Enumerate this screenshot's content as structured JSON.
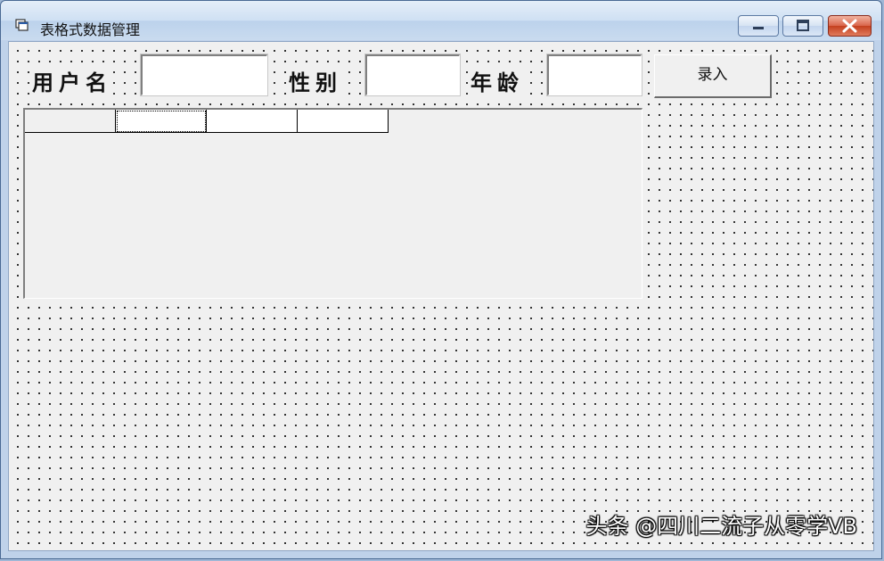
{
  "window": {
    "title": "表格式数据管理",
    "buttons": [
      "minimize",
      "maximize",
      "close"
    ]
  },
  "form": {
    "username_label": "用户名",
    "gender_label": "性别",
    "age_label": "年龄",
    "username_value": "",
    "gender_value": "",
    "age_value": "",
    "submit_label": "录入"
  },
  "grid": {
    "header_cells": [
      "",
      "",
      "",
      ""
    ],
    "rows": []
  },
  "watermark": "头条 @四川二流子从零学VB",
  "colors": {
    "titlebar": "#c9dbef",
    "form_bg": "#f0f0f0",
    "close_button": "#c4401f"
  }
}
